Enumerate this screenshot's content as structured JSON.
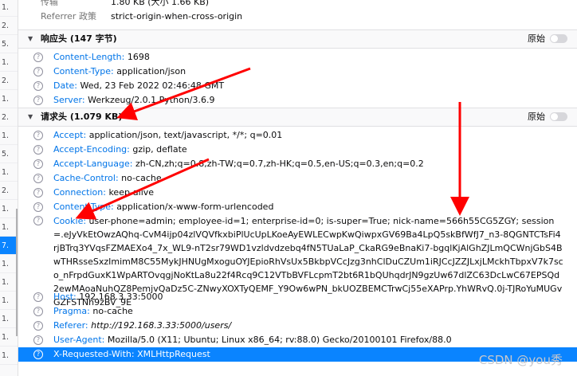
{
  "gutter_items": [
    "1.",
    "2.",
    "5.",
    "1.",
    "2.",
    "1.",
    "2.",
    "1.",
    "5.",
    "1.",
    "2.",
    "1.",
    "1.",
    "7.",
    "1.",
    "1.",
    "1.",
    "1.",
    "1.",
    "1."
  ],
  "top_rows": [
    {
      "key": "传输",
      "value": "1.80 KB (大小 1.66 KB)"
    },
    {
      "key": "Referrer 政策",
      "value": "strict-origin-when-cross-origin"
    }
  ],
  "response_section": {
    "title": "响应头 (147 字节)",
    "raw_label": "原始"
  },
  "response_headers": [
    {
      "key": "Content-Length:",
      "value": "1698"
    },
    {
      "key": "Content-Type:",
      "value": "application/json"
    },
    {
      "key": "Date:",
      "value": "Wed, 23 Feb 2022 02:46:48 GMT"
    },
    {
      "key": "Server:",
      "value": "Werkzeug/2.0.1 Python/3.6.9"
    }
  ],
  "request_section": {
    "title": "请求头 (1.079 KB)",
    "raw_label": "原始"
  },
  "request_headers": [
    {
      "key": "Accept:",
      "value": "application/json, text/javascript, */*; q=0.01"
    },
    {
      "key": "Accept-Encoding:",
      "value": "gzip, deflate"
    },
    {
      "key": "Accept-Language:",
      "value": "zh-CN,zh;q=0.8,zh-TW;q=0.7,zh-HK;q=0.5,en-US;q=0.3,en;q=0.2"
    },
    {
      "key": "Cache-Control:",
      "value": "no-cache"
    },
    {
      "key": "Connection:",
      "value": "keep-alive"
    },
    {
      "key": "Content-Type:",
      "value": "application/x-www-form-urlencoded"
    }
  ],
  "cookie": {
    "key": "Cookie:",
    "value": "user-phone=admin; employee-id=1; enterprise-id=0; is-super=True; nick-name=566h55CG5ZGY; session=.eJyVkEtOwzAQhq-CvM4ijp04zlVQVfkxbiPlUcUpLKoeAyEWLECwpKwQiwpxGV69Ba4LpQ5skBfWfJ7_n3-8QGNTCTsFi4rjBTrq3YVqsFZMAEXo4_7x_WL9-nT2sr79WD1vzldvdzebq4fN5TUaLaP_CkaRG9eBnaKi7-bgqlKjAlGhZJLmQCWnjGbS4BwTHRsseSxzImimM8C55MykJHNUgMxoguOYJEpioRhVsUx5BkbpVCcJzg3nhClDuCZUm1iRJCcJZZJLxjLMckhTbpxV7k7sco_nFrpdGuxK1WpARTOvqgjNoKtLa8u22f4Rcq9C12VTbBVFLcpmT2bt6R1bQUhqdrJN9gzUw67dlZC63DcLwC67EPSQd2ewMAoaNuhQZ8PemjvQaDz5C-ZNwyXOXTyQEMF_Y9Ow6wPN_bkUOZBEMCTrwCj55eXAPrp.YhWRvQ.0j-TJRoYuMUGvGZFSTNh9zBV_9E"
  },
  "request_headers_after": [
    {
      "key": "Host:",
      "value": "192.168.3.33:5000"
    },
    {
      "key": "Pragma:",
      "value": "no-cache"
    },
    {
      "key": "Referer:",
      "value": "http://192.168.3.33:5000/users/"
    },
    {
      "key": "User-Agent:",
      "value": "Mozilla/5.0 (X11; Ubuntu; Linux x86_64; rv:88.0) Gecko/20100101 Firefox/88.0"
    },
    {
      "key": "X-Requested-With:",
      "value": "XMLHttpRequest"
    }
  ],
  "watermark": "CSDN @you秀",
  "colors": {
    "header_key": "#0074e8",
    "selection": "#0a84ff",
    "annotation_arrow": "#ff0000"
  }
}
